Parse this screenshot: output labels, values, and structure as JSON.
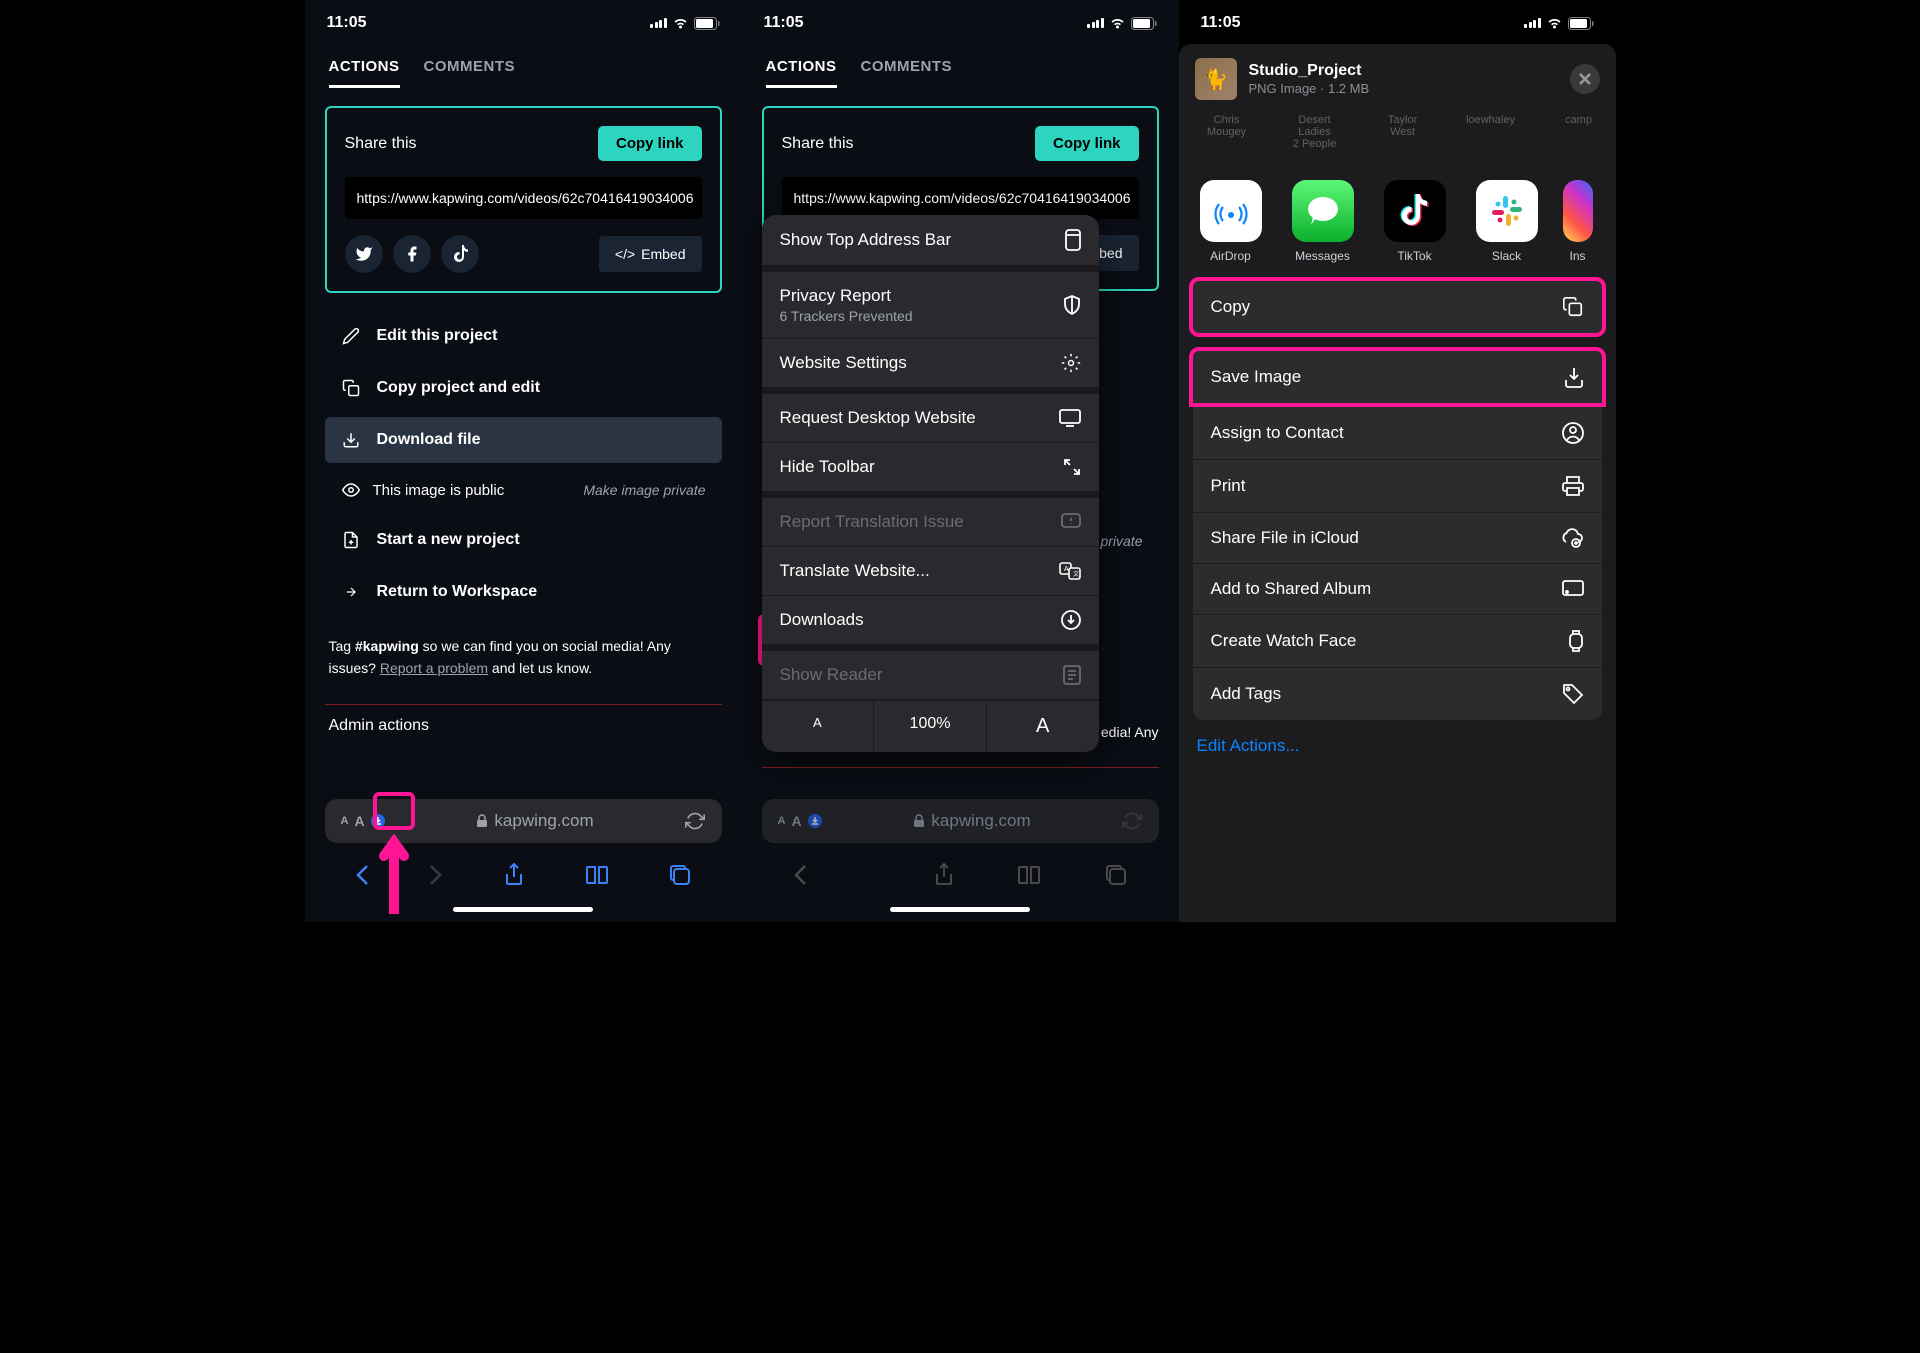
{
  "status": {
    "time": "11:05"
  },
  "screen1": {
    "tabs": {
      "actions": "ACTIONS",
      "comments": "COMMENTS"
    },
    "share": {
      "title": "Share this",
      "copy": "Copy link",
      "url": "https://www.kapwing.com/videos/62c70416419034006",
      "embed": "Embed"
    },
    "actions": {
      "edit": "Edit this project",
      "copy": "Copy project and edit",
      "download": "Download file",
      "public_label": "This image is public",
      "make_private": "Make image private",
      "new_project": "Start a new project",
      "return": "Return to Workspace"
    },
    "tag_prefix": "Tag ",
    "tag_hashtag": "#kapwing",
    "tag_suffix": " so we can find you on social media! Any issues?  ",
    "report": "Report a problem",
    "tag_end": "  and let us know.",
    "admin": "Admin actions",
    "domain": "kapwing.com"
  },
  "screen2": {
    "tabs": {
      "actions": "ACTIONS",
      "comments": "COMMENTS"
    },
    "share": {
      "title": "Share this",
      "copy": "Copy link",
      "url": "https://www.kapwing.com/videos/62c70416419034006",
      "embed": "mbed"
    },
    "public_suffix": "age private",
    "tag_suffix": "edia! Any",
    "menu": {
      "show_top": "Show Top Address Bar",
      "privacy": "Privacy Report",
      "privacy_sub": "6 Trackers Prevented",
      "settings": "Website Settings",
      "desktop": "Request Desktop Website",
      "hide_toolbar": "Hide Toolbar",
      "translation": "Report Translation Issue",
      "translate": "Translate Website...",
      "downloads": "Downloads",
      "reader": "Show Reader",
      "zoom_small": "A",
      "zoom_pct": "100%",
      "zoom_big": "A"
    },
    "domain": "kapwing.com"
  },
  "screen3": {
    "file": {
      "name": "Studio_Project",
      "meta": "PNG Image · 1.2 MB"
    },
    "people": [
      {
        "name": "Chris",
        "sub": "Mougey"
      },
      {
        "name": "Desert Ladies",
        "sub": "2 People"
      },
      {
        "name": "Taylor",
        "sub": "West"
      },
      {
        "name": "loewhaley",
        "sub": ""
      },
      {
        "name": "camp",
        "sub": ""
      }
    ],
    "apps": {
      "airdrop": "AirDrop",
      "messages": "Messages",
      "tiktok": "TikTok",
      "slack": "Slack",
      "instagram": "Ins"
    },
    "actions": {
      "copy": "Copy",
      "save": "Save Image",
      "assign": "Assign to Contact",
      "print": "Print",
      "icloud": "Share File in iCloud",
      "album": "Add to Shared Album",
      "watch": "Create Watch Face",
      "tags": "Add Tags"
    },
    "edit": "Edit Actions..."
  }
}
